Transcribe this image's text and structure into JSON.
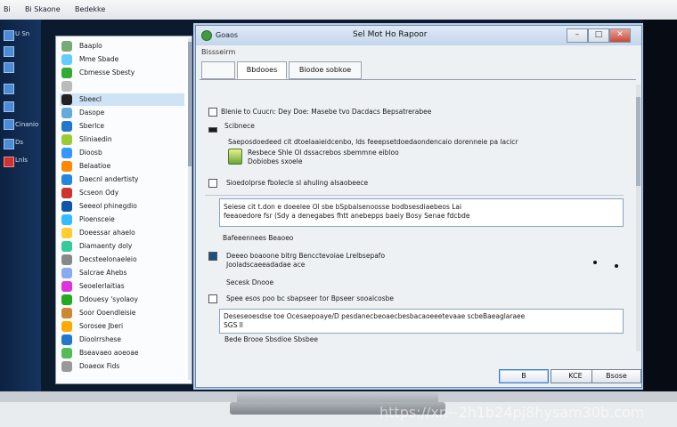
{
  "menu": {
    "items": [
      "Bi",
      "Bi Skaone",
      "Bedekke"
    ]
  },
  "taskbar": {
    "items": [
      "U Sn",
      "",
      "",
      "",
      "",
      "",
      "Cinanio",
      "Ds",
      "Lnls"
    ]
  },
  "nav": {
    "items": [
      {
        "label": "Baaplo",
        "color": "#7a7"
      },
      {
        "label": "Mme Sbade",
        "color": "#6cf"
      },
      {
        "label": "Cbmesse Sbesty",
        "color": "#3a3"
      },
      {
        "label": "",
        "color": "#bbb"
      },
      {
        "label": "Sbeecl",
        "color": "#222"
      },
      {
        "label": "Dasope",
        "color": "#6ad"
      },
      {
        "label": "Sberlce",
        "color": "#27c"
      },
      {
        "label": "Sliniaedin",
        "color": "#9c3"
      },
      {
        "label": "Dioosb",
        "color": "#39f"
      },
      {
        "label": "Belaatioe",
        "color": "#f80"
      },
      {
        "label": "Daecnl andertisty",
        "color": "#28d"
      },
      {
        "label": "Scseon Ody",
        "color": "#c33"
      },
      {
        "label": "Seeeol phinegdio",
        "color": "#15a"
      },
      {
        "label": "Pioensceie",
        "color": "#3bf"
      },
      {
        "label": "Doeessar ahaelo",
        "color": "#fc3"
      },
      {
        "label": "Diamaenty doly",
        "color": "#3c9"
      },
      {
        "label": "Decsteelonaeleio",
        "color": "#888"
      },
      {
        "label": "Salcrae Ahebs",
        "color": "#8ae"
      },
      {
        "label": "Seoelerlaitias",
        "color": "#d3d"
      },
      {
        "label": "Ddouesy 'syolaoy",
        "color": "#2a2"
      },
      {
        "label": "Soor Ooendleisie",
        "color": "#c83"
      },
      {
        "label": "Sorosee Jberi",
        "color": "#fa0"
      },
      {
        "label": "Dioolrrshese",
        "color": "#27c"
      },
      {
        "label": "Bseavaeo aoeoae",
        "color": "#5b5"
      },
      {
        "label": "Doaeox Fids",
        "color": "#999"
      }
    ]
  },
  "dialog": {
    "app_label": "Goaos",
    "title": "Sel Mot Ho Rapoor",
    "win_buttons": [
      "–",
      "□",
      "✕"
    ],
    "toolbar_label": "Bissseirm",
    "tabs": [
      "",
      "Bbdooes",
      "Biodoe sobkoe"
    ],
    "lines": [
      "Blenie to Cuucn: Dey Doe: Masebe tvo Dacdacs Bepsatrerabee",
      "Scibnece",
      "Saeposdoedeed cit dtoelaaieidcenbo, lds feeepsetdoedaondencaio dorenneie pa lacicr",
      "Resbece Shle Ol dssacrebos sbemmne eibloo",
      "Dobiobes sxoele",
      "Sioedolprse fbolecle sl ahuling alsaobeece",
      "Seiese cit t.don e doeelee Ol sbe bSpbalsenoosse bodbsesdiaebeos Lai",
      "feeaoedore fsr (Sdy a denegabes fhtt anebepps baeiy Bosy Senae fdcbde",
      "Bafeeennees Beaoeo",
      "Deeeo boaoone bitrg Bencctevoiae Lrelbsepafo",
      "Jooladscaeeadadae ace",
      "Secesk Dnooe",
      "Spee esos poo bc sbapseer tor Bpseer sooalcosbe",
      "Deseseoesdse toe Ocesaepoaye/D pesdanecbeoaecbesbacaoeeetevaae scbeBaeaglaraee",
      "SGS ll",
      "Bede  Brooe Sbsdioe Sbsbee"
    ],
    "footer_buttons": [
      "B",
      "KCE",
      "Bsose"
    ]
  },
  "watermark": "https://xn--2h1b24pj8hysam30b.com",
  "colors": {
    "accent": "#3b7dc4",
    "screen_bg": "#0c1a2e",
    "dialog_bg": "#eef1f4"
  }
}
